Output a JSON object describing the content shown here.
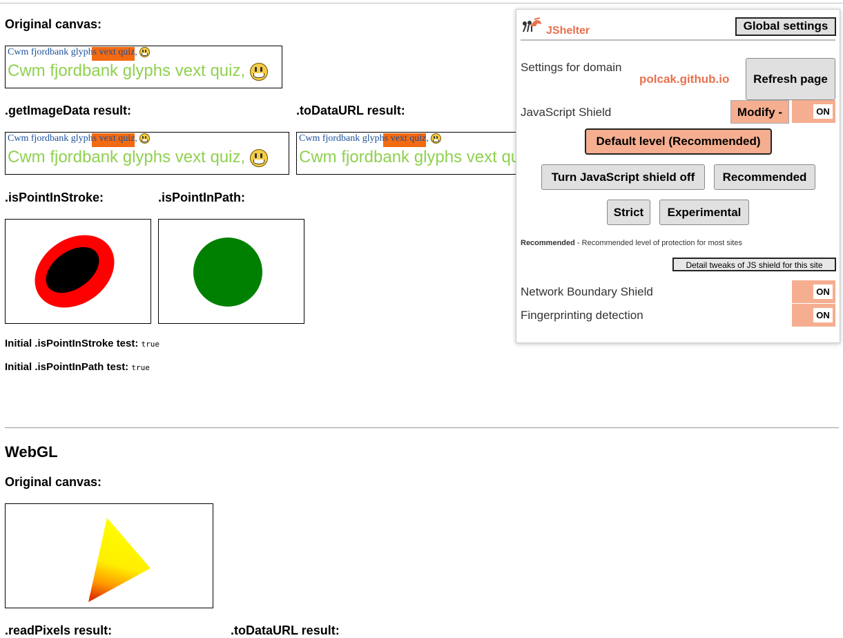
{
  "canvas_section": {
    "original_heading": "Original canvas:",
    "sample_text": "Cwm fjordbank glyphs vext quiz,",
    "getimagedata_heading": ".getImageData result:",
    "todataurl_heading": ".toDataURL result:",
    "ispointinstroke_heading": ".isPointInStroke:",
    "ispointinpath_heading": ".isPointInPath:",
    "stroke_test_label": "Initial .isPointInStroke test:",
    "stroke_test_value": "true",
    "path_test_label": "Initial .isPointInPath test:",
    "path_test_value": "true",
    "colors": {
      "small_text": "#1a4f9c",
      "large_text": "#8fd14f",
      "highlight": "#f26a11",
      "ellipse_outer": "#ff0000",
      "ellipse_inner": "#000000",
      "circle": "#008000"
    }
  },
  "webgl_section": {
    "title": "WebGL",
    "original_heading": "Original canvas:",
    "readpixels_heading": ".readPixels result:",
    "todataurl_heading": ".toDataURL result:"
  },
  "popup": {
    "logo_icon": "crab-icon",
    "app_name": "JShelter",
    "global_settings": "Global settings",
    "settings_for_domain": "Settings for domain",
    "domain": "polcak.github.io",
    "refresh_page": "Refresh page",
    "js_shield_label": "JavaScript Shield",
    "modify_button": "Modify -",
    "default_level": "Default level (Recommended)",
    "level_buttons": [
      "Turn JavaScript shield off",
      "Recommended",
      "Strict",
      "Experimental"
    ],
    "level_desc_title": "Recommended",
    "level_desc_text": " - Recommended level of protection for most sites",
    "detail_tweaks": "Detail tweaks of JS shield for this site",
    "network_boundary_label": "Network Boundary Shield",
    "fingerprinting_label": "Fingerprinting detection",
    "toggle_on": "ON",
    "accent_color": "#e8704c",
    "toggle_color": "#f5ae90"
  }
}
